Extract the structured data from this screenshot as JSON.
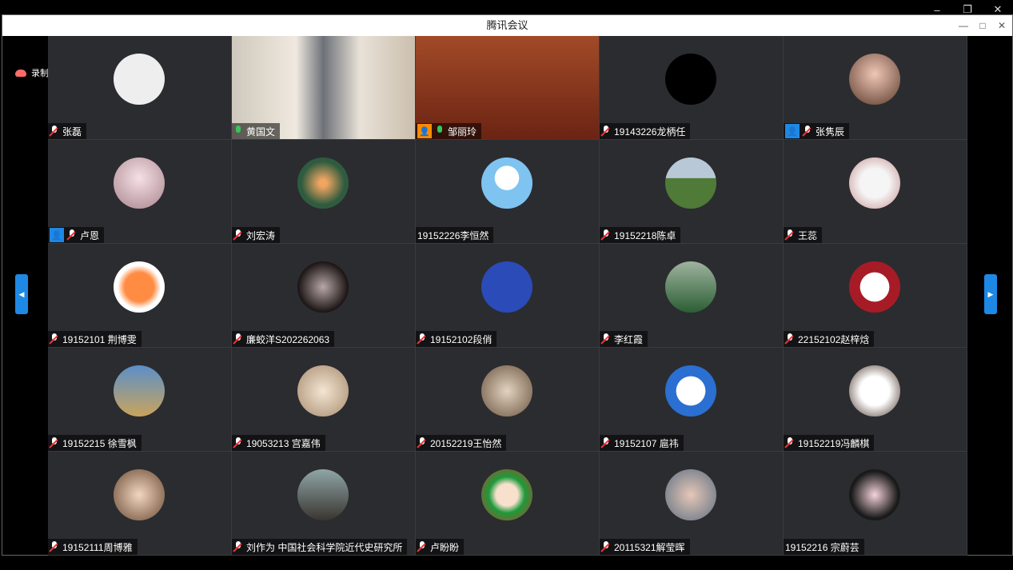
{
  "app": {
    "title": "腾讯会议",
    "recording_label": "录制中"
  },
  "controls": {
    "outer_minimize": "–",
    "outer_restore": "❐",
    "outer_close": "✕",
    "minimize": "—",
    "maximize": "□",
    "close": "✕",
    "prev": "◀",
    "next": "▶"
  },
  "participants": [
    {
      "name": "张磊",
      "muted": true
    },
    {
      "name": "黄国文",
      "muted": false,
      "video": true
    },
    {
      "name": "邹丽玲",
      "muted": false,
      "video": true,
      "host": true
    },
    {
      "name": "19143226龙柄任",
      "muted": true
    },
    {
      "name": "张隽辰",
      "muted": true,
      "host": true
    },
    {
      "name": "卢恩",
      "muted": true,
      "host": true
    },
    {
      "name": "刘宏涛",
      "muted": true
    },
    {
      "name": "19152226李恒然",
      "muted": false
    },
    {
      "name": "19152218陈卓",
      "muted": true
    },
    {
      "name": "王蕊",
      "muted": true
    },
    {
      "name": "19152101 荆博雯",
      "muted": true
    },
    {
      "name": "廉蛟洋S202262063",
      "muted": true
    },
    {
      "name": "19152102段俏",
      "muted": true
    },
    {
      "name": "李红霞",
      "muted": true
    },
    {
      "name": "22152102赵梓焓",
      "muted": true
    },
    {
      "name": "19152215 徐雪枫",
      "muted": true
    },
    {
      "name": "19053213 宫嘉伟",
      "muted": true
    },
    {
      "name": "20152219王怡然",
      "muted": true
    },
    {
      "name": "19152107 扈祎",
      "muted": true
    },
    {
      "name": "19152219冯麟棋",
      "muted": true
    },
    {
      "name": "19152111周博雅",
      "muted": true
    },
    {
      "name": "刘作为 中国社会科学院近代史研究所",
      "muted": true
    },
    {
      "name": "卢盼盼",
      "muted": true
    },
    {
      "name": "20115321解莹晖",
      "muted": true
    },
    {
      "name": "19152216 宗蔚芸",
      "muted": false
    }
  ]
}
